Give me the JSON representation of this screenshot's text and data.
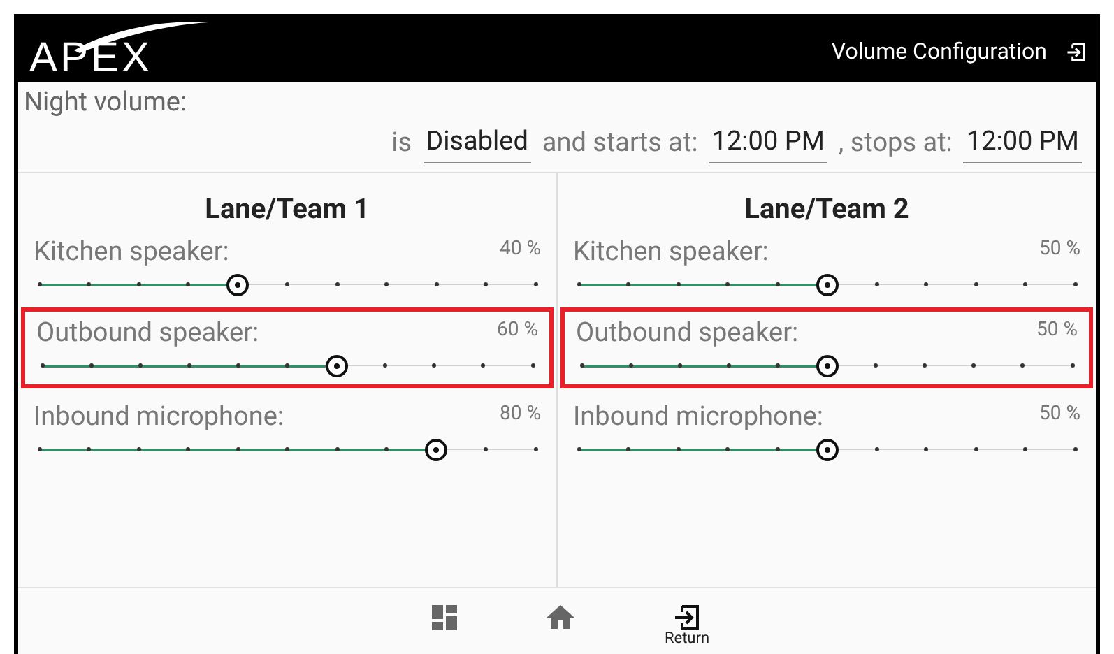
{
  "header": {
    "logo": "APEX",
    "title": "Volume Configuration"
  },
  "night_volume": {
    "label": "Night volume:",
    "prefix": "is",
    "state": "Disabled",
    "starts_label": "and starts at:",
    "starts": "12:00 PM",
    "stops_label": ", stops at:",
    "stops": "12:00 PM"
  },
  "lanes": [
    {
      "title": "Lane/Team 1",
      "sliders": [
        {
          "label": "Kitchen speaker:",
          "reading": "40 %",
          "level": 0.4,
          "highlighted": false
        },
        {
          "label": "Outbound speaker:",
          "reading": "60 %",
          "level": 0.6,
          "highlighted": true
        },
        {
          "label": "Inbound microphone:",
          "reading": "80 %",
          "level": 0.8,
          "highlighted": false
        }
      ]
    },
    {
      "title": "Lane/Team 2",
      "sliders": [
        {
          "label": "Kitchen speaker:",
          "reading": "50 %",
          "level": 0.5,
          "highlighted": false
        },
        {
          "label": "Outbound speaker:",
          "reading": "50 %",
          "level": 0.5,
          "highlighted": true
        },
        {
          "label": "Inbound microphone:",
          "reading": "50 %",
          "level": 0.5,
          "highlighted": false
        }
      ]
    }
  ],
  "bottom_nav": [
    {
      "kind": "dashboard"
    },
    {
      "kind": "home"
    },
    {
      "kind": "return",
      "label": "Return"
    }
  ]
}
